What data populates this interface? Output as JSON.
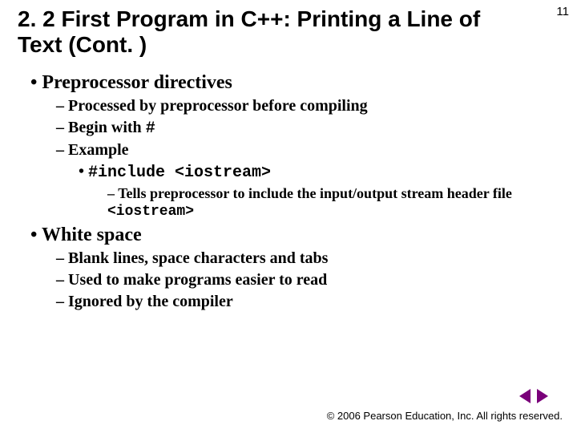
{
  "page_number": "11",
  "title": "2. 2 First Program in C++: Printing a Line of Text (Cont. )",
  "bullets": {
    "b1": "Preprocessor directives",
    "b1_1": "Processed by preprocessor before compiling",
    "b1_2_pre": "Begin with ",
    "b1_2_code": "#",
    "b1_3": "Example",
    "b1_3_1": "#include <iostream>",
    "b1_3_1_1_pre": "Tells preprocessor to include the input/output stream header file ",
    "b1_3_1_1_code": "<iostream>",
    "b2": "White space",
    "b2_1": "Blank lines, space characters and tabs",
    "b2_2": "Used to make programs easier to read",
    "b2_3": "Ignored by the compiler"
  },
  "footer": "© 2006 Pearson Education, Inc.  All rights reserved.",
  "nav": {
    "prev": "previous slide",
    "next": "next slide"
  }
}
